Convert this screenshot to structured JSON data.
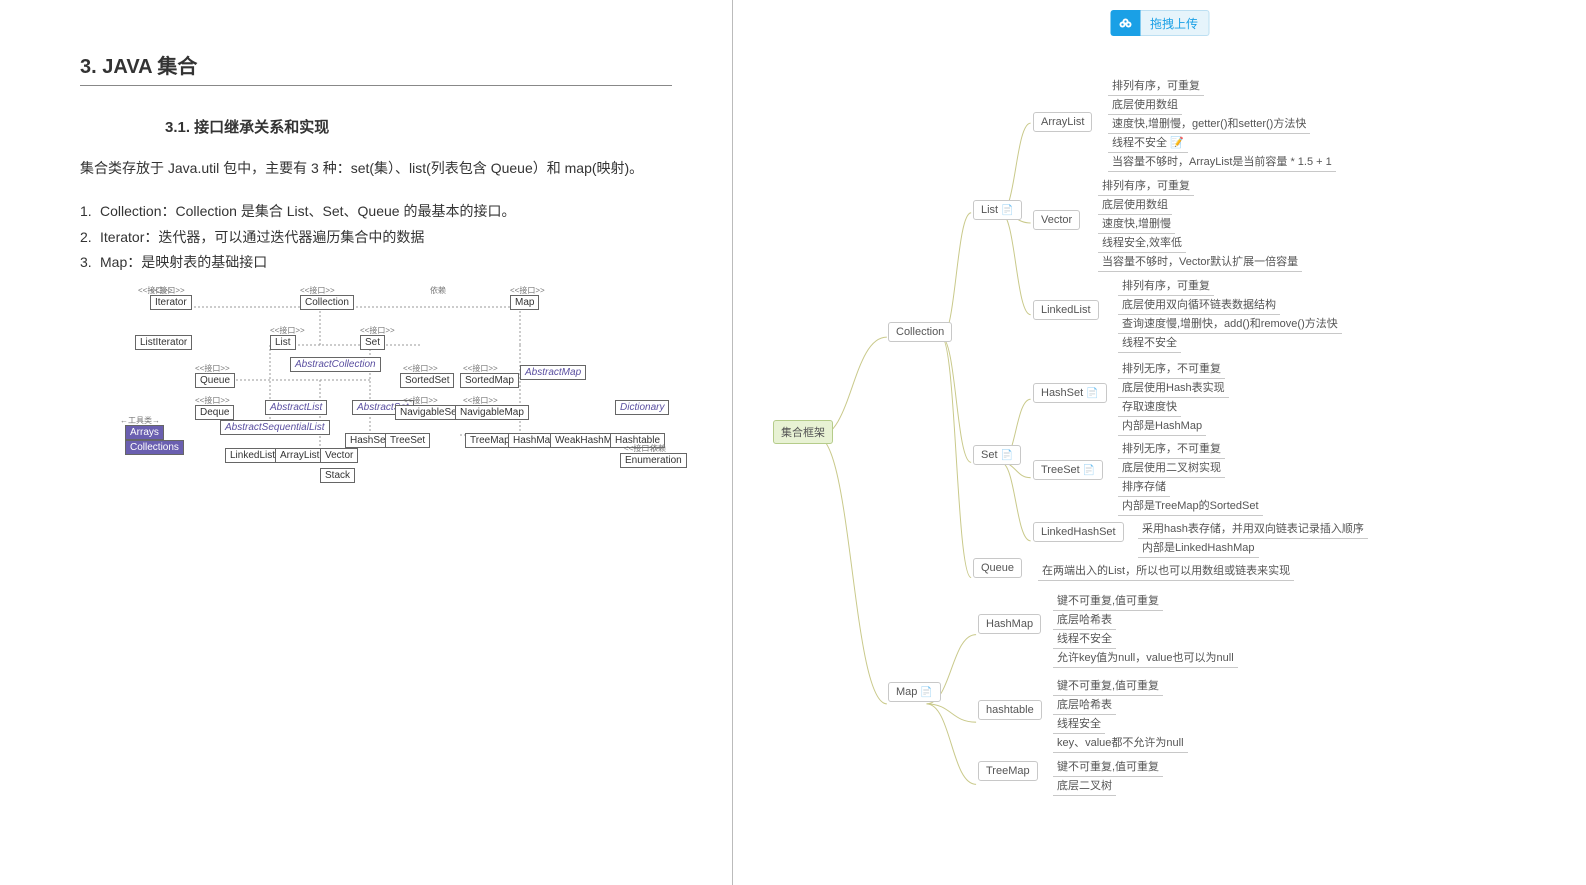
{
  "upload": {
    "label": "拖拽上传"
  },
  "doc": {
    "title": "3. JAVA 集合",
    "subtitle": "3.1. 接口继承关系和实现",
    "intro": "集合类存放于 Java.util 包中，主要有 3 种：set(集）、list(列表包含 Queue）和 map(映射)。",
    "points": [
      "Collection：Collection 是集合 List、Set、Queue 的最基本的接口。",
      "Iterator：迭代器，可以通过迭代器遍历集合中的数据",
      "Map：是映射表的基础接口"
    ],
    "uml_tags": {
      "interface": "<<接口>>",
      "depends": "依赖",
      "tools": "←工具类→"
    },
    "uml": {
      "Iterator": "Iterator",
      "ListIterator": "ListIterator",
      "Collection": "Collection",
      "List": "List",
      "Set": "Set",
      "Queue": "Queue",
      "Deque": "Deque",
      "SortedSet": "SortedSet",
      "NavigableSet": "NavigableSet",
      "SortedMap": "SortedMap",
      "NavigableMap": "NavigableMap",
      "Map": "Map",
      "Dictionary": "Dictionary",
      "AbstractCollection": "AbstractCollection",
      "AbstractList": "AbstractList",
      "AbstractSet": "AbstractSet",
      "AbstractMap": "AbstractMap",
      "AbstractSequentialList": "AbstractSequentialList",
      "LinkedList": "LinkedList",
      "ArrayList": "ArrayList",
      "Vector": "Vector",
      "Stack": "Stack",
      "HashSet": "HashSet",
      "TreeSet": "TreeSet",
      "TreeMap": "TreeMap",
      "HashMap": "HashMap",
      "WeakHashMap": "WeakHashMap",
      "Hashtable": "Hashtable",
      "Enumeration": "Enumeration",
      "Arrays": "Arrays",
      "Collections": "Collections"
    }
  },
  "mindmap": {
    "root": "集合框架",
    "Collection": "Collection",
    "Map": "Map",
    "List": "List",
    "Set": "Set",
    "Queue": "Queue",
    "ArrayList": "ArrayList",
    "Vector": "Vector",
    "LinkedList": "LinkedList",
    "HashSet": "HashSet",
    "TreeSet": "TreeSet",
    "LinkedHashSet": "LinkedHashSet",
    "HashMap": "HashMap",
    "hashtable": "hashtable",
    "TreeMap": "TreeMap",
    "arraylist_leaves": [
      "排列有序，可重复",
      "底层使用数组",
      "速度快,增删慢，getter()和setter()方法快",
      "线程不安全 📝",
      "当容量不够时，ArrayList是当前容量 * 1.5 + 1"
    ],
    "vector_leaves": [
      "排列有序，可重复",
      "底层使用数组",
      "速度快,增删慢",
      "线程安全,效率低",
      "当容量不够时，Vector默认扩展一倍容量"
    ],
    "linkedlist_leaves": [
      "排列有序，可重复",
      "底层使用双向循环链表数据结构",
      "查询速度慢,增删快，add()和remove()方法快",
      "线程不安全"
    ],
    "hashset_leaves": [
      "排列无序，不可重复",
      "底层使用Hash表实现",
      "存取速度快",
      "内部是HashMap"
    ],
    "treeset_leaves": [
      "排列无序，不可重复",
      "底层使用二叉树实现",
      "排序存储",
      "内部是TreeMap的SortedSet"
    ],
    "linkedhashset_leaves": [
      "采用hash表存储，并用双向链表记录插入顺序",
      "内部是LinkedHashMap"
    ],
    "queue_leaves": [
      "在两端出入的List，所以也可以用数组或链表来实现"
    ],
    "hashmap_leaves": [
      "键不可重复,值可重复",
      "底层哈希表",
      "线程不安全",
      "允许key值为null，value也可以为null"
    ],
    "hashtable_leaves": [
      "键不可重复,值可重复",
      "底层哈希表",
      "线程安全",
      "key、value都不允许为null"
    ],
    "treemap_leaves": [
      "键不可重复,值可重复",
      "底层二叉树"
    ]
  }
}
